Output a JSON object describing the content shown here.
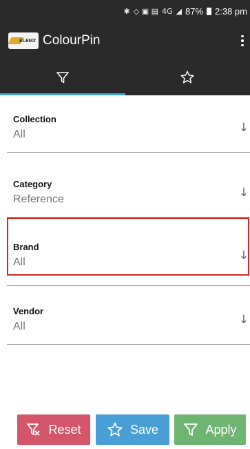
{
  "status_bar": {
    "battery": "87%",
    "time": "2:38 pm",
    "network": "4G"
  },
  "app": {
    "title": "ColourPin",
    "logo_text": "ELEMX"
  },
  "tabs": [
    {
      "icon": "filter-icon",
      "active": true
    },
    {
      "icon": "star-icon",
      "active": false
    }
  ],
  "filters": [
    {
      "label": "Collection",
      "value": "All"
    },
    {
      "label": "Category",
      "value": "Reference"
    },
    {
      "label": "Brand",
      "value": "All",
      "highlighted": true
    },
    {
      "label": "Vendor",
      "value": "All"
    }
  ],
  "buttons": {
    "reset": "Reset",
    "save": "Save",
    "apply": "Apply"
  },
  "colors": {
    "toolbar": "#2a2a2a",
    "tab_indicator": "#39a0d6",
    "reset": "#d4566a",
    "save": "#4a9ed6",
    "apply": "#6fb470",
    "highlight": "#d9261c"
  }
}
